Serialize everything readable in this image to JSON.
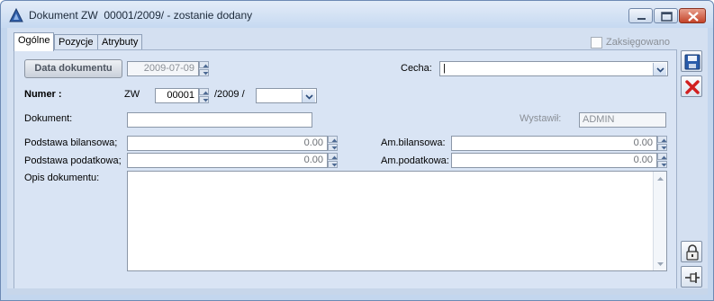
{
  "window": {
    "title": "Dokument ZW  00001/2009/ - zostanie dodany",
    "icons": {
      "app": "triangle-app-icon",
      "minimize": "minimize-icon",
      "maximize": "maximize-icon",
      "close": "close-icon"
    }
  },
  "tabs": [
    {
      "label": "Ogólne",
      "active": true
    },
    {
      "label": "Pozycje",
      "active": false
    },
    {
      "label": "Atrybuty",
      "active": false
    }
  ],
  "zaksiegowano": {
    "label": "Zaksięgowano",
    "checked": false
  },
  "form": {
    "data_dokumentu_button": "Data dokumentu",
    "data_dokumentu_value": "2009-07-09",
    "cecha_label": "Cecha:",
    "cecha_value": "|",
    "numer_label": "Numer :",
    "numer_prefix": "ZW",
    "numer_value": "00001",
    "numer_year": "/2009 /",
    "numer_suffix_value": "",
    "dokument_label": "Dokument:",
    "dokument_value": "",
    "wystawil_label": "Wystawił:",
    "wystawil_value": "ADMIN",
    "podstawa_bilansowa_label": "Podstawa bilansowa;",
    "podstawa_bilansowa_value": "0.00",
    "am_bilansowa_label": "Am.bilansowa:",
    "am_bilansowa_value": "0.00",
    "podstawa_podatkowa_label": "Podstawa podatkowa;",
    "podstawa_podatkowa_value": "0.00",
    "am_podatkowa_label": "Am.podatkowa:",
    "am_podatkowa_value": "0.00",
    "opis_label": "Opis dokumentu:",
    "opis_value": ""
  },
  "side_buttons": {
    "save": "save-icon",
    "cancel": "cancel-icon",
    "lock": "lock-icon",
    "pin": "pin-icon"
  },
  "colors": {
    "window_bg": "#c3d6ee",
    "panel_bg": "#d9e4f4",
    "cancel_red": "#d11f1f",
    "save_blue": "#2a5caa"
  }
}
